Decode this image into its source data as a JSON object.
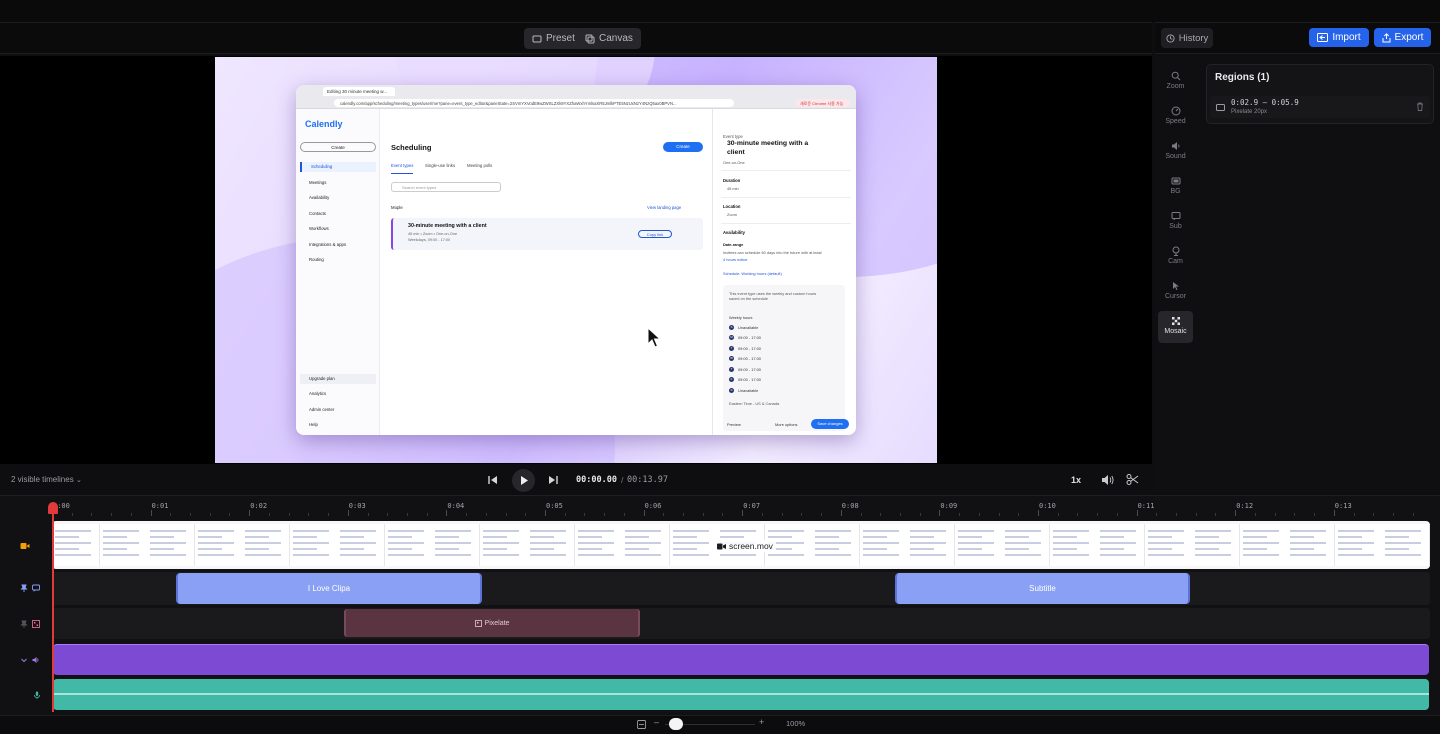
{
  "editor_toolbar": {
    "preset_label": "Preset",
    "canvas_label": "Canvas"
  },
  "right_header": {
    "history_label": "History",
    "import_label": "Import",
    "export_label": "Export"
  },
  "tools": [
    {
      "label": "Zoom",
      "icon": "zoom-icon"
    },
    {
      "label": "Speed",
      "icon": "speed-icon"
    },
    {
      "label": "Sound",
      "icon": "sound-icon"
    },
    {
      "label": "BG",
      "icon": "background-icon"
    },
    {
      "label": "Sub",
      "icon": "subtitle-icon"
    },
    {
      "label": "Cam",
      "icon": "camera-icon"
    },
    {
      "label": "Cursor",
      "icon": "cursor-icon"
    },
    {
      "label": "Mosaic",
      "icon": "mosaic-icon",
      "active": true
    }
  ],
  "regions": {
    "title": "Regions (1)",
    "items": [
      {
        "range": "0:02.9 – 0:05.9",
        "detail": "Pixelate 20px"
      }
    ]
  },
  "transport": {
    "timelines_label": "2 visible timelines",
    "current_time": "00:00.00",
    "separator": "/",
    "total_time": "00:13.97",
    "speed": "1x"
  },
  "ruler": {
    "labels": [
      "0:00",
      "0:01",
      "0:02",
      "0:03",
      "0:04",
      "0:05",
      "0:06",
      "0:07",
      "0:08",
      "0:09",
      "0:10",
      "0:11",
      "0:12",
      "0:13"
    ]
  },
  "tracks": {
    "video_name": "screen.mov",
    "subtitle_clips": [
      "I Love Clipa",
      "Subtitle"
    ],
    "mosaic_clip": "Pixelate"
  },
  "zoom": {
    "minus": "–",
    "plus": "+",
    "percent": "100%"
  },
  "browser_capture": {
    "tab_title": "Editing 30 minute meeting w...",
    "url": "calendly.com/app/scheduling/meeting_types/user/me?pane=event_type_editor&paneState=2SVmYXVodE9wZWSLZXk9YXZhaWxhYmlsaXR5JmlkPTE5NzUxNzY4NzQ5ax0BPVN...",
    "ext_badge": "새로운 Chrome 사용 가능",
    "logo": "Calendly",
    "create_label": "Create",
    "nav": [
      "Scheduling",
      "Meetings",
      "Availability",
      "Contacts",
      "Workflows",
      "Integrations & apps",
      "Routing"
    ],
    "nav_bottom": [
      "Upgrade plan",
      "Analytics",
      "Admin center",
      "Help"
    ],
    "main_title": "Scheduling",
    "create_blue": "Create",
    "subtabs": [
      "Event types",
      "Single-use links",
      "Meeting polls"
    ],
    "search_placeholder": "Search event types",
    "user_row": "Mople",
    "landing_link": "View landing page",
    "event_title": "30-minute meeting with a client",
    "event_sub": "45 min • Zoom • One-on-One",
    "event_sub2": "Weekdays, 09:00 - 17:00",
    "copy_link": "Copy link",
    "panel": {
      "event_type_label": "Event type",
      "title": "30-minute meeting with a client",
      "kind": "One-on-One",
      "duration_label": "Duration",
      "duration_value": "45 min",
      "location_label": "Location",
      "location_value": "Zoom",
      "availability_label": "Availability",
      "date_range_label": "Date-range",
      "date_range_text": "Invitees can schedule 60 days into the future with at least",
      "notice_text": "4 hours notice",
      "schedule_text": "Schedule: Working hours (default)",
      "box_text": "This event type uses the weekly and custom hours saved on the schedule",
      "weekly_label": "Weekly hours",
      "days": [
        {
          "d": "S",
          "t": "Unavailable"
        },
        {
          "d": "M",
          "t": "09:00  -  17:00"
        },
        {
          "d": "T",
          "t": "09:00  -  17:00"
        },
        {
          "d": "W",
          "t": "09:00  -  17:00"
        },
        {
          "d": "T",
          "t": "09:00  -  17:00"
        },
        {
          "d": "F",
          "t": "09:00  -  17:00"
        },
        {
          "d": "S",
          "t": "Unavailable"
        }
      ],
      "timezone": "Eastern Time - US & Canada",
      "preview": "Preview",
      "more_options": "More options",
      "save": "Save changes"
    }
  },
  "colors": {
    "accent": "#2563eb",
    "playhead": "#e03a3a",
    "subtitle_clip": "#8aa0f4",
    "mosaic_clip": "#5b3442",
    "audio": "#7d4bd3",
    "mic": "#42b9a6"
  }
}
